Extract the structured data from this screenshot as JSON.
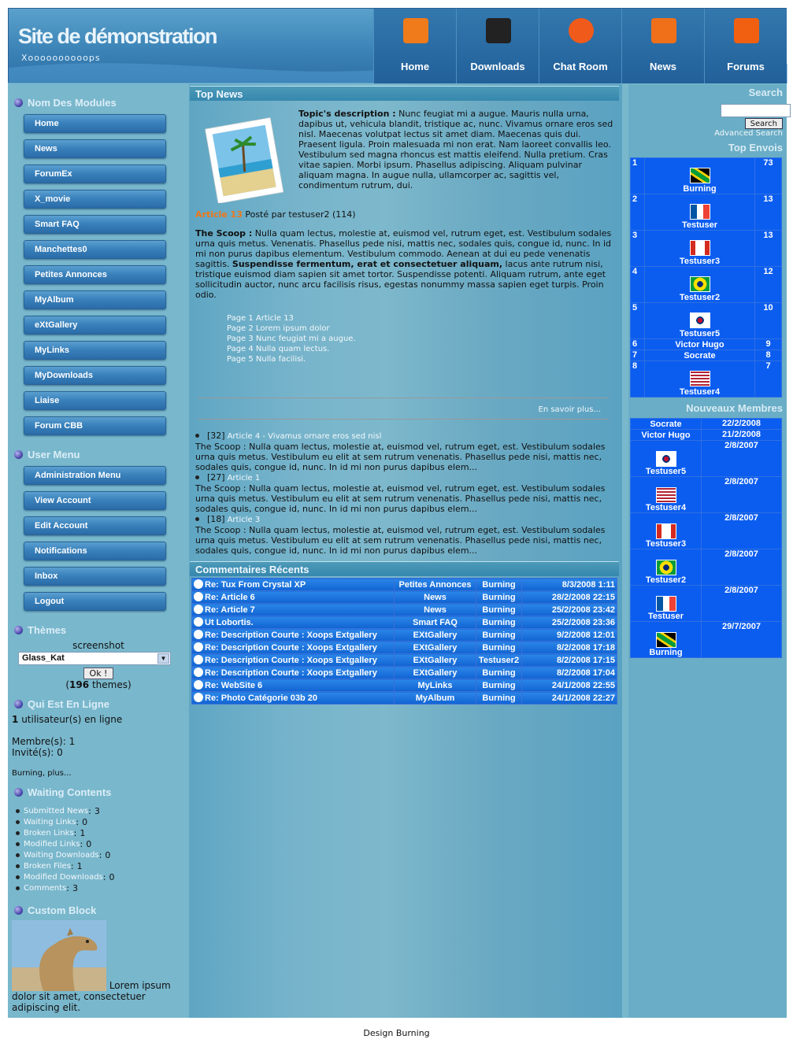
{
  "header": {
    "title": "Site de démonstration",
    "slogan": "Xoooooooooops"
  },
  "nav": [
    {
      "label": "Home",
      "icon": "home-icon",
      "color": "#f07b1a"
    },
    {
      "label": "Downloads",
      "icon": "downloads-icon",
      "color": "#222222"
    },
    {
      "label": "Chat Room",
      "icon": "chat-icon",
      "color": "#f05a1a"
    },
    {
      "label": "News",
      "icon": "news-icon",
      "color": "#f0701a"
    },
    {
      "label": "Forums",
      "icon": "forums-icon",
      "color": "#f06010"
    }
  ],
  "modules": {
    "title": "Nom Des Modules",
    "items": [
      "Home",
      "News",
      "ForumEx",
      "X_movie",
      "Smart FAQ",
      "Manchettes0",
      "Petites Annonces",
      "MyAlbum",
      "eXtGallery",
      "MyLinks",
      "MyDownloads",
      "Liaise",
      "Forum CBB"
    ]
  },
  "usermenu": {
    "title": "User Menu",
    "items": [
      "Administration Menu",
      "View Account",
      "Edit Account",
      "Notifications",
      "Inbox",
      "Logout"
    ]
  },
  "themes": {
    "title": "Thèmes",
    "caption": "screenshot",
    "selected": "Glass_Kat",
    "button": "Ok !",
    "count": "196",
    "count_suffix": "themes)",
    "count_prefix": "("
  },
  "online": {
    "title": "Qui Est En Ligne",
    "count": "1",
    "count_text": "utilisateur(s) en ligne",
    "members": "Membre(s): 1",
    "guests": "Invité(s): 0",
    "user": "Burning",
    "more": "plus..."
  },
  "waiting": {
    "title": "Waiting Contents",
    "items": [
      {
        "label": "Submitted News",
        "value": "3"
      },
      {
        "label": "Waiting Links",
        "value": "0"
      },
      {
        "label": "Broken Links",
        "value": "1"
      },
      {
        "label": "Modified Links",
        "value": "0"
      },
      {
        "label": "Waiting Downloads",
        "value": "0"
      },
      {
        "label": "Broken Files",
        "value": "1"
      },
      {
        "label": "Modified Downloads",
        "value": "0"
      },
      {
        "label": "Comments",
        "value": "3"
      }
    ]
  },
  "custom": {
    "title": "Custom Block",
    "text": "Lorem ipsum dolor sit amet, consectetuer adipiscing elit."
  },
  "topnews": {
    "title": "Top News",
    "desc_label": "Topic's description :",
    "desc": "Nunc feugiat mi a augue. Mauris nulla urna, dapibus ut, vehicula blandit, tristique ac, nunc. Vivamus ornare eros sed nisl. Maecenas volutpat lectus sit amet diam. Maecenas quis dui. Praesent ligula. Proin malesuada mi non erat. Nam laoreet convallis leo. Vestibulum sed magna rhoncus est mattis eleifend. Nulla pretium. Cras vitae sapien. Morbi ipsum. Phasellus adipiscing. Aliquam pulvinar aliquam magna. In augue nulla, ullamcorper ac, sagittis vel, condimentum rutrum, dui.",
    "article_link": "Article 13",
    "posted_by": "Posté par testuser2 (114)",
    "scoop_label": "The Scoop :",
    "scoop1": "Nulla quam lectus, molestie at, euismod vel, rutrum eget, est. Vestibulum sodales urna quis metus. Venenatis. Phasellus pede nisi, mattis nec, sodales quis, congue id, nunc. In id mi non purus dapibus elementum. Vestibulum commodo. Aenean at dui eu pede venenatis sagittis.",
    "scoop_bold": "Suspendisse fermentum, erat et consectetuer aliquam,",
    "scoop2": "lacus ante rutrum nisi, tristique euismod diam sapien sit amet tortor. Suspendisse potenti. Aliquam rutrum, ante eget sollicitudin auctor, nunc arcu facilisis risus, egestas nonummy massa sapien eget turpis. Proin odio.",
    "pages": [
      "Page 1 Article 13",
      "Page 2 Lorem ipsum dolor",
      "Page 3 Nunc feugiat mi a augue.",
      "Page 4 Nulla quam lectus.",
      "Page 5 Nulla facilisi."
    ],
    "more": "En savoir plus...",
    "list": [
      {
        "count": "[32]",
        "link": "Article 4 - Vivamus ornare eros sed nisl"
      },
      {
        "count": "[27]",
        "link": "Article 1"
      },
      {
        "count": "[18]",
        "link": "Article 3"
      }
    ],
    "list_text": "The Scoop : Nulla quam lectus, molestie at, euismod vel, rutrum eget, est. Vestibulum sodales urna quis metus. Vestibulum eu elit at sem rutrum venenatis. Phasellus pede nisi, mattis nec, sodales quis, congue id, nunc. In id mi non purus dapibus elem..."
  },
  "comments": {
    "title": "Commentaires Récents",
    "rows": [
      [
        "Re: Tux From Crystal XP",
        "Petites Annonces",
        "Burning",
        "8/3/2008 1:11"
      ],
      [
        "Re: Article 6",
        "News",
        "Burning",
        "28/2/2008 22:15"
      ],
      [
        "Re: Article 7",
        "News",
        "Burning",
        "25/2/2008 23:42"
      ],
      [
        "Ut Lobortis.",
        "Smart FAQ",
        "Burning",
        "25/2/2008 23:36"
      ],
      [
        "Re: Description Courte : Xoops Extgallery",
        "EXtGallery",
        "Burning",
        "9/2/2008 12:01"
      ],
      [
        "Re: Description Courte : Xoops Extgallery",
        "EXtGallery",
        "Burning",
        "8/2/2008 17:18"
      ],
      [
        "Re: Description Courte : Xoops Extgallery",
        "EXtGallery",
        "Testuser2",
        "8/2/2008 17:15"
      ],
      [
        "Re: Description Courte : Xoops Extgallery",
        "EXtGallery",
        "Burning",
        "8/2/2008 17:04"
      ],
      [
        "Re: WebSite 6",
        "MyLinks",
        "Burning",
        "24/1/2008 22:55"
      ],
      [
        "Re: Photo Catégorie 03b 20",
        "MyAlbum",
        "Burning",
        "24/1/2008 22:27"
      ]
    ]
  },
  "search": {
    "title": "Search",
    "button": "Search",
    "advanced": "Advanced Search"
  },
  "topposters": {
    "title": "Top Envois",
    "rows": [
      {
        "rank": "1",
        "name": "Burning",
        "posts": "73",
        "flag": "jamaica"
      },
      {
        "rank": "2",
        "name": "Testuser",
        "posts": "13",
        "flag": "france"
      },
      {
        "rank": "3",
        "name": "Testuser3",
        "posts": "13",
        "flag": "canada"
      },
      {
        "rank": "4",
        "name": "Testuser2",
        "posts": "12",
        "flag": "brazil"
      },
      {
        "rank": "5",
        "name": "Testuser5",
        "posts": "10",
        "flag": "korea"
      },
      {
        "rank": "6",
        "name": "Victor Hugo",
        "posts": "9",
        "flag": ""
      },
      {
        "rank": "7",
        "name": "Socrate",
        "posts": "8",
        "flag": ""
      },
      {
        "rank": "8",
        "name": "Testuser4",
        "posts": "7",
        "flag": "usa"
      }
    ]
  },
  "newmembers": {
    "title": "Nouveaux Membres",
    "rows": [
      {
        "name": "Socrate",
        "date": "22/2/2008",
        "flag": ""
      },
      {
        "name": "Victor Hugo",
        "date": "21/2/2008",
        "flag": ""
      },
      {
        "name": "Testuser5",
        "date": "2/8/2007",
        "flag": "korea"
      },
      {
        "name": "Testuser4",
        "date": "2/8/2007",
        "flag": "usa"
      },
      {
        "name": "Testuser3",
        "date": "2/8/2007",
        "flag": "canada"
      },
      {
        "name": "Testuser2",
        "date": "2/8/2007",
        "flag": "brazil"
      },
      {
        "name": "Testuser",
        "date": "2/8/2007",
        "flag": "france"
      },
      {
        "name": "Burning",
        "date": "29/7/2007",
        "flag": "jamaica"
      }
    ]
  },
  "footer": {
    "text": "Design Burning"
  }
}
